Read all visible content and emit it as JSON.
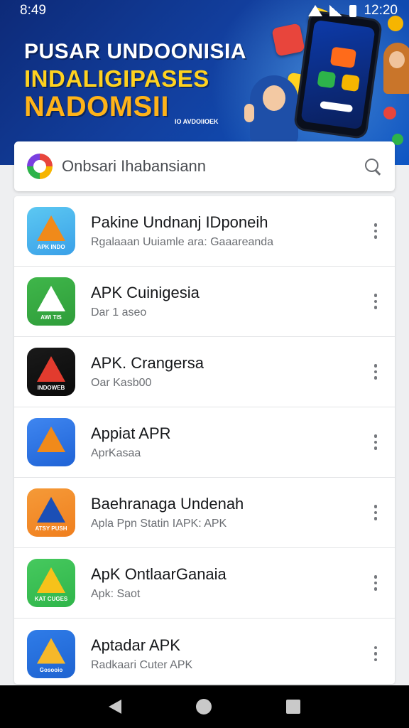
{
  "status_bar": {
    "time": "8:49",
    "clock_right": "12:20"
  },
  "banner": {
    "line1": "PUSAR UNDOONISIA",
    "line2": "INDALIGIPASES",
    "line3": "NADOMSII",
    "tagline": "IO AVDOIIOEK"
  },
  "search": {
    "placeholder": "Onbsari Ihabansiann"
  },
  "apps": [
    {
      "title": "Pakine Undnanj IDponeih",
      "subtitle": "Rgalaaan Uuiamle ara: Gaaareanda",
      "icon": "orange-triangle-icon",
      "colors": [
        "#3aa0e8",
        "#5cc8f2"
      ],
      "mark": "#f08a1a",
      "caption": "APK INDO"
    },
    {
      "title": "APK Cuinigesia",
      "subtitle": "Dar 1 aseo",
      "icon": "white-a-icon",
      "colors": [
        "#2f9d3a",
        "#3fb64a"
      ],
      "mark": "#ffffff",
      "caption": "AWI TIS"
    },
    {
      "title": "APK. Crangersa",
      "subtitle": "Oar Kasb00",
      "icon": "red-swoosh-icon",
      "colors": [
        "#0a0a0a",
        "#1a1a1a"
      ],
      "mark": "#e23b2e",
      "caption": "INDOWEB"
    },
    {
      "title": "Appiat APR",
      "subtitle": "AprKasaa",
      "icon": "blue-a-icon",
      "colors": [
        "#1f63d6",
        "#3f86f0"
      ],
      "mark": "#f08a1a",
      "caption": ""
    },
    {
      "title": "Baehranaga Undenah",
      "subtitle": "Apla Ppn Statin IAPK: APK",
      "icon": "infinity-logo-icon",
      "colors": [
        "#f07f1e",
        "#f59a38"
      ],
      "mark": "#1b4fb6",
      "caption": "ATSY PUSH"
    },
    {
      "title": "ApK OntlaarGanaia",
      "subtitle": "Apk: Saot",
      "icon": "green-arrow-icon",
      "colors": [
        "#2fb54a",
        "#46c95e"
      ],
      "mark": "#f6c21a",
      "caption": "KAT CUGES"
    },
    {
      "title": "Aptadar APK",
      "subtitle": "Radkaari Cuter APK",
      "icon": "color-triangle-icon",
      "colors": [
        "#1e63d1",
        "#2f7ce8"
      ],
      "mark": "#f6b82a",
      "caption": "Gosooio"
    }
  ]
}
